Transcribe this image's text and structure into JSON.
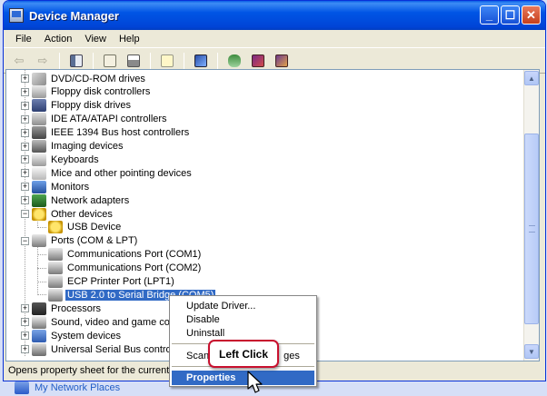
{
  "window": {
    "title": "Device Manager",
    "controls": [
      "minimize",
      "maximize",
      "close"
    ]
  },
  "menubar": [
    "File",
    "Action",
    "View",
    "Help"
  ],
  "toolbar": [
    "back-arrow-icon",
    "forward-arrow-icon",
    "console-tree-icon",
    "properties-icon",
    "print-icon",
    "help-icon",
    "scan-hardware-icon",
    "update-driver-icon",
    "uninstall-icon",
    "disable-icon"
  ],
  "tree": [
    {
      "label": "DVD/CD-ROM drives",
      "icon": "dvd-drive-icon",
      "level": 0,
      "expander": "+"
    },
    {
      "label": "Floppy disk controllers",
      "icon": "floppy-controller-icon",
      "level": 0,
      "expander": "+"
    },
    {
      "label": "Floppy disk drives",
      "icon": "floppy-drive-icon",
      "level": 0,
      "expander": "+"
    },
    {
      "label": "IDE ATA/ATAPI controllers",
      "icon": "ide-controller-icon",
      "level": 0,
      "expander": "+"
    },
    {
      "label": "IEEE 1394 Bus host controllers",
      "icon": "firewire-icon",
      "level": 0,
      "expander": "+"
    },
    {
      "label": "Imaging devices",
      "icon": "camera-icon",
      "level": 0,
      "expander": "+"
    },
    {
      "label": "Keyboards",
      "icon": "keyboard-icon",
      "level": 0,
      "expander": "+"
    },
    {
      "label": "Mice and other pointing devices",
      "icon": "mouse-icon",
      "level": 0,
      "expander": "+"
    },
    {
      "label": "Monitors",
      "icon": "monitor-icon",
      "level": 0,
      "expander": "+"
    },
    {
      "label": "Network adapters",
      "icon": "network-card-icon",
      "level": 0,
      "expander": "+"
    },
    {
      "label": "Other devices",
      "icon": "unknown-device-icon",
      "level": 0,
      "expander": "-"
    },
    {
      "label": "USB Device",
      "icon": "unknown-device-icon",
      "level": 1,
      "expander": ""
    },
    {
      "label": "Ports (COM & LPT)",
      "icon": "port-icon",
      "level": 0,
      "expander": "-"
    },
    {
      "label": "Communications Port (COM1)",
      "icon": "port-icon",
      "level": 1,
      "expander": ""
    },
    {
      "label": "Communications Port (COM2)",
      "icon": "port-icon",
      "level": 1,
      "expander": ""
    },
    {
      "label": "ECP Printer Port (LPT1)",
      "icon": "port-icon",
      "level": 1,
      "expander": ""
    },
    {
      "label": "USB 2.0 to Serial Bridge (COM5)",
      "icon": "port-icon",
      "level": 1,
      "expander": "",
      "selected": true
    },
    {
      "label": "Processors",
      "icon": "processor-icon",
      "level": 0,
      "expander": "+"
    },
    {
      "label": "Sound, video and game cor",
      "icon": "sound-icon",
      "level": 0,
      "expander": "+"
    },
    {
      "label": "System devices",
      "icon": "system-icon",
      "level": 0,
      "expander": "+"
    },
    {
      "label": "Universal Serial Bus controll",
      "icon": "usb-icon",
      "level": 0,
      "expander": "+"
    }
  ],
  "context_menu": {
    "items": [
      "Update Driver...",
      "Disable",
      "Uninstall",
      "Scan",
      "ges",
      "Properties"
    ],
    "highlighted": "Properties"
  },
  "callout": {
    "text": "Left Click"
  },
  "statusbar": {
    "text": "Opens property sheet for the current se"
  },
  "desktop": {
    "bottom_item": "My Network Places"
  },
  "colors": {
    "titlebar": "#0055e5",
    "selection": "#316ac5",
    "callout_border": "#c8102e"
  }
}
